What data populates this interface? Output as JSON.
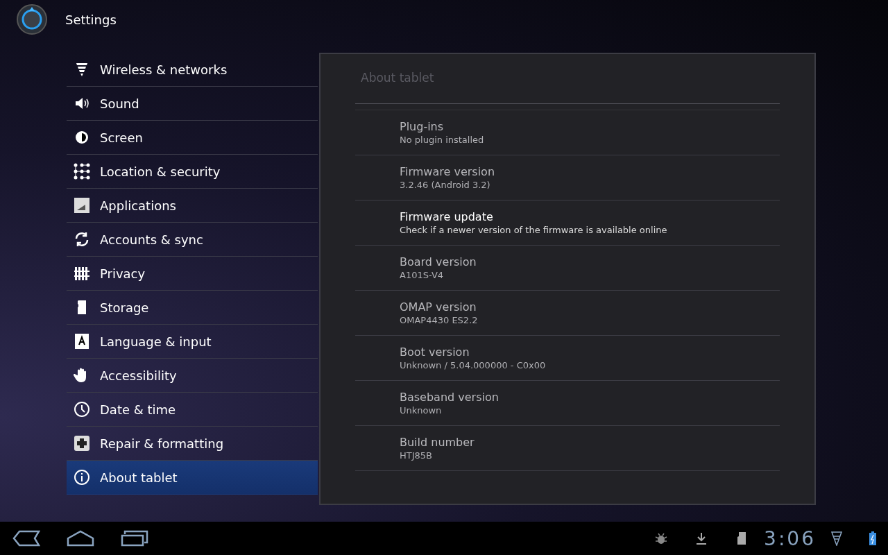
{
  "window": {
    "title": "Settings"
  },
  "sidebar": {
    "items": [
      {
        "label": "Wireless & networks",
        "selected": false
      },
      {
        "label": "Sound",
        "selected": false
      },
      {
        "label": "Screen",
        "selected": false
      },
      {
        "label": "Location & security",
        "selected": false
      },
      {
        "label": "Applications",
        "selected": false
      },
      {
        "label": "Accounts & sync",
        "selected": false
      },
      {
        "label": "Privacy",
        "selected": false
      },
      {
        "label": "Storage",
        "selected": false
      },
      {
        "label": "Language & input",
        "selected": false
      },
      {
        "label": "Accessibility",
        "selected": false
      },
      {
        "label": "Date & time",
        "selected": false
      },
      {
        "label": "Repair & formatting",
        "selected": false
      },
      {
        "label": "About tablet",
        "selected": true
      }
    ]
  },
  "panel": {
    "title": "About tablet",
    "rows": [
      {
        "title": "Plug-ins",
        "summary": "No plugin installed",
        "disabled": true
      },
      {
        "title": "Firmware version",
        "summary": "3.2.46  (Android 3.2)",
        "disabled": true
      },
      {
        "title": "Firmware update",
        "summary": "Check if a newer version of the firmware is available online",
        "disabled": false
      },
      {
        "title": "Board version",
        "summary": "A101S-V4",
        "disabled": true
      },
      {
        "title": "OMAP version",
        "summary": "OMAP4430 ES2.2",
        "disabled": true
      },
      {
        "title": "Boot version",
        "summary": "Unknown / 5.04.000000 - C0x00",
        "disabled": true
      },
      {
        "title": "Baseband version",
        "summary": "Unknown",
        "disabled": true
      },
      {
        "title": "Build number",
        "summary": "HTJ85B",
        "disabled": true
      }
    ]
  },
  "status_bar": {
    "time": "3:06"
  }
}
